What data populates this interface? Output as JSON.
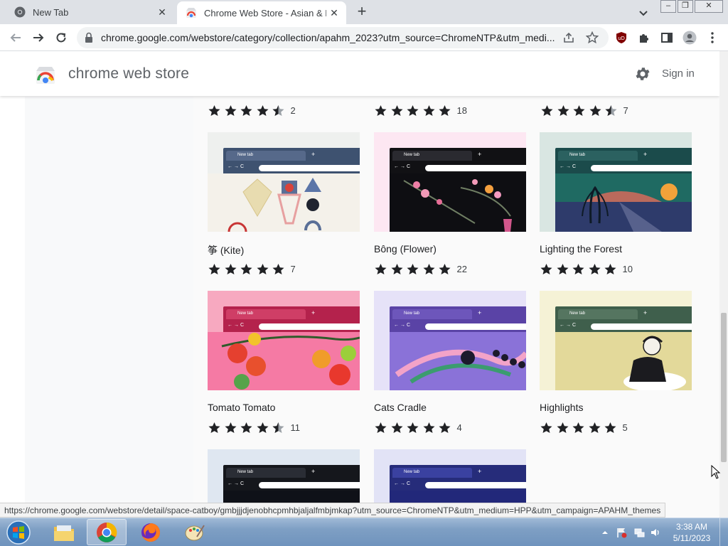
{
  "browser": {
    "tabs": [
      {
        "title": "New Tab",
        "active": false,
        "icon": "chrome-icon"
      },
      {
        "title": "Chrome Web Store - Asian & Pac",
        "active": true,
        "icon": "webstore-icon"
      }
    ],
    "new_tab_symbol": "+",
    "url": "chrome.google.com/webstore/category/collection/apahm_2023?utm_source=ChromeNTP&utm_medi...",
    "window_controls": [
      "minimize",
      "restore",
      "close"
    ]
  },
  "store": {
    "title": "chrome web store",
    "signin_label": "Sign in"
  },
  "top_ratings": [
    {
      "count": "2",
      "stars": 4.5
    },
    {
      "count": "18",
      "stars": 5
    },
    {
      "count": "7",
      "stars": 4.5
    }
  ],
  "themes": [
    {
      "name": "筝 (Kite)",
      "count": "7",
      "stars": 5
    },
    {
      "name": "Bông (Flower)",
      "count": "22",
      "stars": 5
    },
    {
      "name": "Lighting the Forest",
      "count": "10",
      "stars": 5
    },
    {
      "name": "Tomato Tomato",
      "count": "11",
      "stars": 4.5
    },
    {
      "name": "Cats Cradle",
      "count": "4",
      "stars": 5
    },
    {
      "name": "Highlights",
      "count": "5",
      "stars": 5
    }
  ],
  "mini_tab_label": "New tab",
  "status_url": "https://chrome.google.com/webstore/detail/space-catboy/gmbjjjdjenobhcpmhbjaljalfmbjmkap?utm_source=ChromeNTP&utm_medium=HPP&utm_campaign=APAHM_themes",
  "taskbar": {
    "time": "3:38 AM",
    "date": "5/11/2023",
    "apps": [
      "file-explorer-icon",
      "chrome-icon",
      "firefox-icon",
      "paint-icon"
    ]
  },
  "colors": {
    "star": "#202124",
    "header_text": "#5f6368",
    "accent_blue": "#1a73e8"
  }
}
